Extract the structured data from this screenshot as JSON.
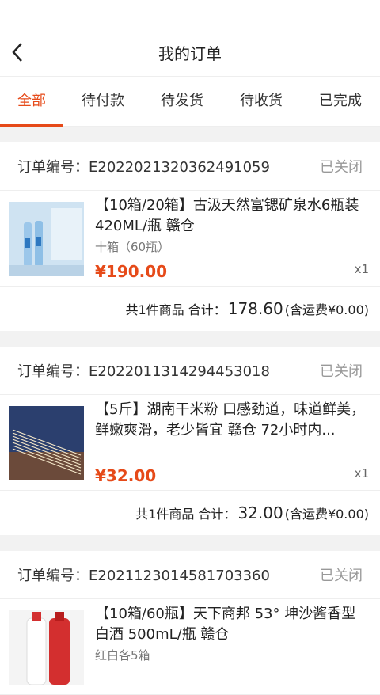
{
  "header": {
    "title": "我的订单"
  },
  "tabs": [
    {
      "label": "全部"
    },
    {
      "label": "待付款"
    },
    {
      "label": "待发货"
    },
    {
      "label": "待收货"
    },
    {
      "label": "已完成"
    }
  ],
  "orders": [
    {
      "order_no": "订单编号：E2022021320362491059",
      "status": "已关闭",
      "item_title": "【10箱/20箱】古汲天然富锶矿泉水6瓶装420ML/瓶  赣仓",
      "item_spec": "十箱（60瓶）",
      "item_price": "¥190.00",
      "item_qty": "x1",
      "summary": "共1件商品  合计：",
      "total": "178.60",
      "shipping": "(含运费¥0.00)"
    },
    {
      "order_no": "订单编号：E2022011314294453018",
      "status": "已关闭",
      "item_title": "【5斤】湖南干米粉  口感劲道，味道鲜美，鲜嫩爽滑，老少皆宜 赣仓 72小时内...",
      "item_spec": "",
      "item_price": "¥32.00",
      "item_qty": "x1",
      "summary": "共1件商品  合计：",
      "total": "32.00",
      "shipping": "(含运费¥0.00)"
    },
    {
      "order_no": "订单编号：E2021123014581703360",
      "status": "已关闭",
      "item_title": "【10箱/60瓶】天下商邦 53° 坤沙酱香型白酒 500mL/瓶  赣仓",
      "item_spec": "红白各5箱",
      "item_price": "",
      "item_qty": ""
    }
  ],
  "colors": {
    "accent": "#e64a19",
    "status": "#999999"
  },
  "icons": {
    "back": "chevron-left-icon"
  }
}
